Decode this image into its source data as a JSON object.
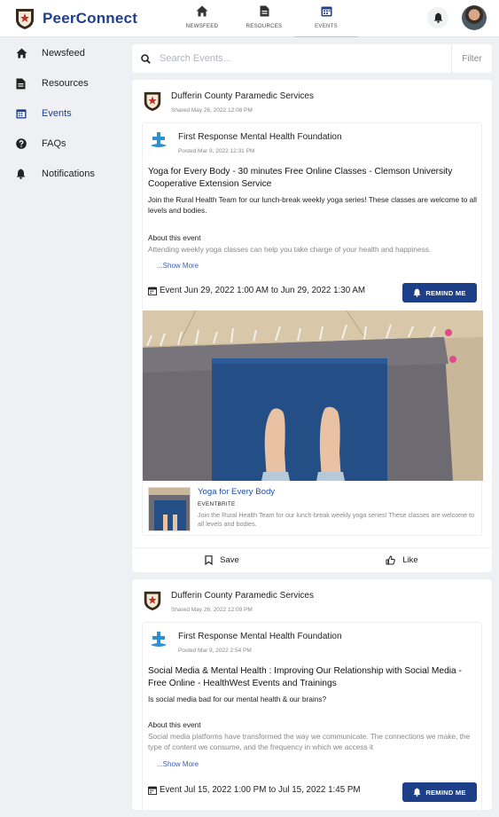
{
  "app": {
    "name": "PeerConnect"
  },
  "nav": {
    "tabs": [
      {
        "label": "NEWSFEED",
        "icon": "home-icon"
      },
      {
        "label": "RESOURCES",
        "icon": "document-icon"
      },
      {
        "label": "EVENTS",
        "icon": "calendar-icon",
        "active": true
      }
    ]
  },
  "sidebar": {
    "items": [
      {
        "label": "Newsfeed",
        "icon": "home-icon"
      },
      {
        "label": "Resources",
        "icon": "document-icon"
      },
      {
        "label": "Events",
        "icon": "calendar-icon",
        "active": true
      },
      {
        "label": "FAQs",
        "icon": "question-circle-icon"
      },
      {
        "label": "Notifications",
        "icon": "bell-icon"
      }
    ]
  },
  "search": {
    "placeholder": "Search Events...",
    "filter_label": "Filter"
  },
  "posts": [
    {
      "poster": "Dufferin County Paramedic Services",
      "shared": "Shared May 26, 2022 12:08 PM",
      "foundation": "First Response Mental Health Foundation",
      "posted": "Posted Mar 9, 2022 12:31 PM",
      "title": "Yoga for Every Body - 30 minutes Free Online Classes - Clemson University Cooperative Extension Service",
      "description": "Join the Rural Health Team for our lunch-break weekly yoga series! These classes are welcome to all levels and bodies.",
      "about_heading": "About this event",
      "about_text": "Attending weekly yoga classes can help you take charge of your health and happiness.",
      "show_more": "...Show More",
      "event_time": "Event Jun 29, 2022 1:00 AM to Jun 29, 2022 1:30 AM",
      "remind_label": "REMIND ME",
      "link": {
        "title": "Yoga for Every Body",
        "source": "EVENTBRITE",
        "description": "Join the Rural Health Team for our lunch-break weekly yoga series! These classes are welcome to all levels and bodies."
      },
      "save_label": "Save",
      "like_label": "Like"
    },
    {
      "poster": "Dufferin County Paramedic Services",
      "shared": "Shared May 26, 2022 12:09 PM",
      "foundation": "First Response Mental Health Foundation",
      "posted": "Posted Mar 9, 2022 2:54 PM",
      "title": "Social Media & Mental Health : Improving Our Relationship with Social Media - Free Online - HealthWest Events and Trainings",
      "description": "Is social media bad for our mental health & our brains?",
      "about_heading": "About this event",
      "about_text": "Social media platforms have transformed the way we communicate. The connections we make, the type of content we consume, and the frequency in which we access it",
      "show_more": "...Show More",
      "event_time": "Event Jul 15, 2022 1:00 PM to Jul 15, 2022 1:45 PM",
      "remind_label": "REMIND ME"
    }
  ],
  "colors": {
    "brand": "#1f3f8f",
    "remind_button": "#1d3f87",
    "background": "#eef0f3"
  }
}
